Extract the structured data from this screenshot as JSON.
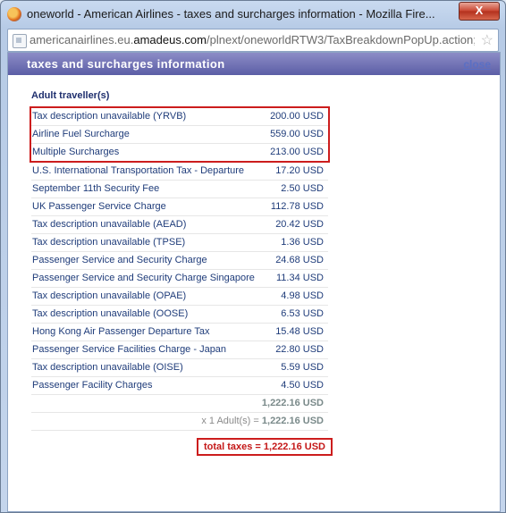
{
  "window": {
    "title": "oneworld - American Airlines - taxes and surcharges information - Mozilla Fire...",
    "close_label": "X"
  },
  "urlbar": {
    "url_prefix": "americanairlines.eu.",
    "url_domain": "amadeus.com",
    "url_rest": "/plnext/oneworldRTW3/TaxBreakdownPopUp.action;jsessi"
  },
  "popup": {
    "header_title": "taxes and surcharges information",
    "close_link": "close",
    "section_title": "Adult traveller(s)",
    "highlighted_rows": [
      {
        "label": "Tax description unavailable (YRVB)",
        "amount": "200.00 USD"
      },
      {
        "label": "Airline Fuel Surcharge",
        "amount": "559.00 USD"
      },
      {
        "label": "Multiple Surcharges",
        "amount": "213.00 USD"
      }
    ],
    "rows": [
      {
        "label": "U.S. International Transportation Tax - Departure",
        "amount": "17.20 USD"
      },
      {
        "label": "September 11th Security Fee",
        "amount": "2.50 USD"
      },
      {
        "label": "UK Passenger Service Charge",
        "amount": "112.78 USD"
      },
      {
        "label": "Tax description unavailable (AEAD)",
        "amount": "20.42 USD"
      },
      {
        "label": "Tax description unavailable (TPSE)",
        "amount": "1.36 USD"
      },
      {
        "label": "Passenger Service and Security Charge",
        "amount": "24.68 USD"
      },
      {
        "label": "Passenger Service and Security Charge Singapore",
        "amount": "11.34 USD"
      },
      {
        "label": "Tax description unavailable (OPAE)",
        "amount": "4.98 USD"
      },
      {
        "label": "Tax description unavailable (OOSE)",
        "amount": "6.53 USD"
      },
      {
        "label": "Hong Kong Air Passenger Departure Tax",
        "amount": "15.48 USD"
      },
      {
        "label": "Passenger Service Facilities Charge - Japan",
        "amount": "22.80 USD"
      },
      {
        "label": "Tax description unavailable (OISE)",
        "amount": "5.59 USD"
      },
      {
        "label": "Passenger Facility Charges",
        "amount": "4.50 USD"
      }
    ],
    "subtotal": "1,222.16 USD",
    "per_adult_prefix": "x 1 Adult(s) = ",
    "per_adult_value": "1,222.16 USD",
    "total": "total taxes = 1,222.16 USD"
  }
}
